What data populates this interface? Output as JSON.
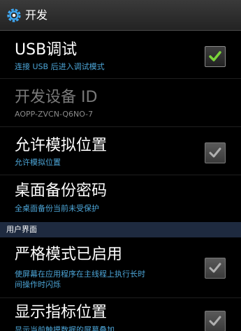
{
  "header": {
    "title": "开发",
    "icon": "gear-icon"
  },
  "rows": [
    {
      "title": "USB调试",
      "summary": "连接 USB 后进入调试模式",
      "checked": true
    },
    {
      "title": "开发设备 ID",
      "summary": "AOPP-ZVCN-Q6NO-7"
    },
    {
      "title": "允许模拟位置",
      "summary": "允许模拟位置",
      "checked": true
    },
    {
      "title": "桌面备份密码",
      "summary": "全桌面备份当前未受保护"
    },
    {
      "title": "严格模式已启用",
      "summary_line1": "使屏幕在应用程序在主线程上执行长时",
      "summary_line2": "间操作时闪烁",
      "checked": true
    },
    {
      "title": "显示指标位置",
      "summary": "显示当前触摸数据的屏幕叠加",
      "checked": true
    }
  ],
  "section_header": "用户界面",
  "colors": {
    "accent": "#4da6d8",
    "check_green": "#7ad33a",
    "check_gray": "#b0b0b0",
    "section_bg": "#1e2a3f"
  }
}
